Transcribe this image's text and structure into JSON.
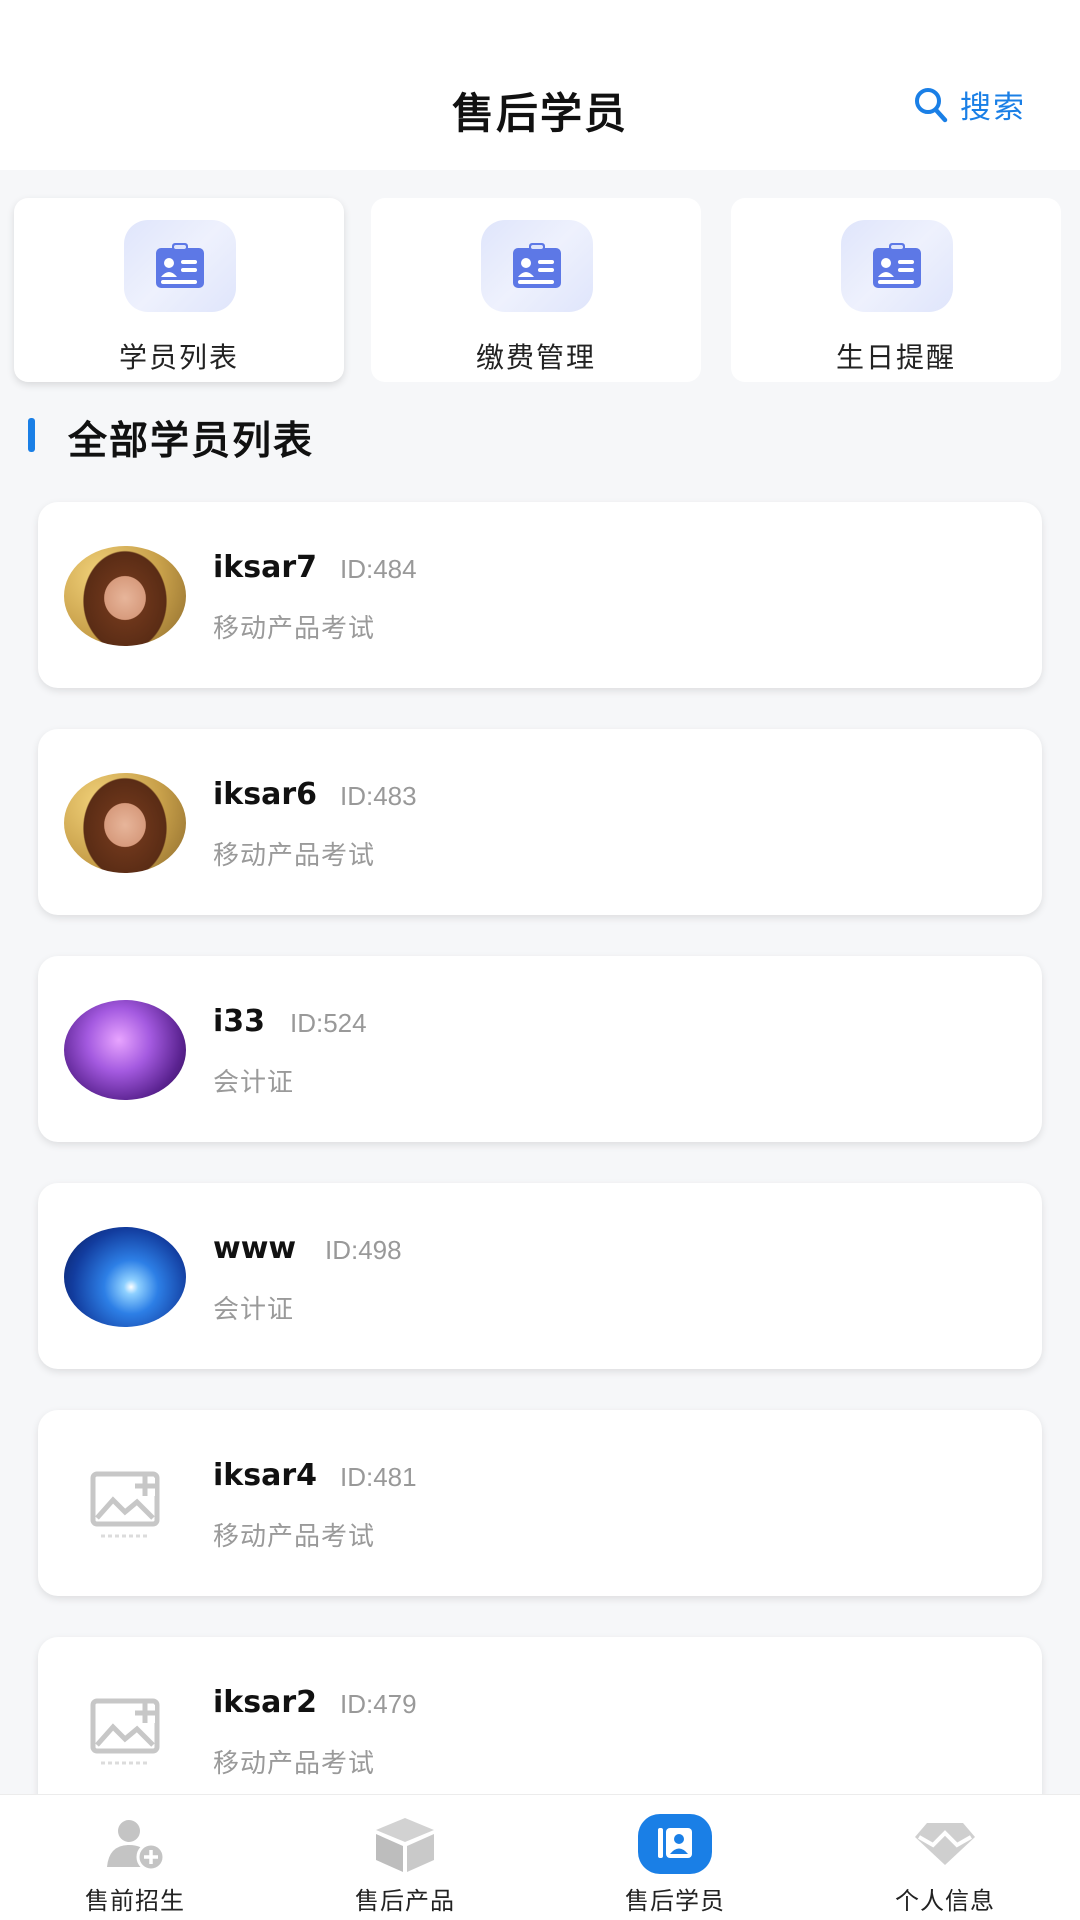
{
  "header": {
    "title": "售后学员",
    "search_label": "搜索"
  },
  "tiles": [
    {
      "label": "学员列表",
      "icon": "id-card-icon"
    },
    {
      "label": "缴费管理",
      "icon": "id-card-icon"
    },
    {
      "label": "生日提醒",
      "icon": "id-card-icon"
    }
  ],
  "section": {
    "title": "全部学员列表"
  },
  "students": [
    {
      "name": "iksar7",
      "id": "ID:484",
      "course": "移动产品考试",
      "avatar": "woman-photo"
    },
    {
      "name": "iksar6",
      "id": "ID:483",
      "course": "移动产品考试",
      "avatar": "woman-photo"
    },
    {
      "name": "i33",
      "id": "ID:524",
      "course": "会计证",
      "avatar": "purple-space-photo"
    },
    {
      "name": "www",
      "id": "ID:498",
      "course": "会计证",
      "avatar": "blue-space-photo"
    },
    {
      "name": "iksar4",
      "id": "ID:481",
      "course": "移动产品考试",
      "avatar": "image-placeholder-icon"
    },
    {
      "name": "iksar2",
      "id": "ID:479",
      "course": "移动产品考试",
      "avatar": "image-placeholder-icon"
    }
  ],
  "tabbar": [
    {
      "label": "售前招生",
      "icon": "add-user-icon",
      "active": false
    },
    {
      "label": "售后产品",
      "icon": "box-icon",
      "active": false
    },
    {
      "label": "售后学员",
      "icon": "contacts-icon",
      "active": true
    },
    {
      "label": "个人信息",
      "icon": "diamond-icon",
      "active": false
    }
  ],
  "colors": {
    "accent": "#1a7fe6",
    "background": "#f6f7f9",
    "card": "#ffffff",
    "muted_text": "#999999",
    "tile_icon": "#5d78e6"
  }
}
